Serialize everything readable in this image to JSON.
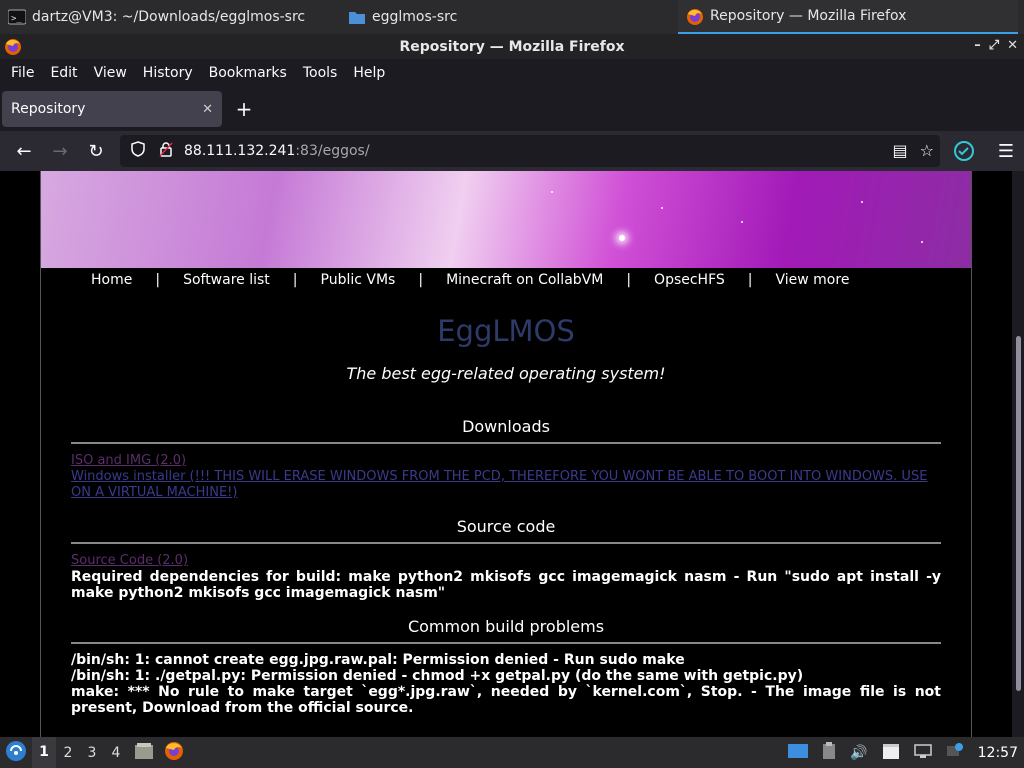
{
  "taskbar_top": {
    "items": [
      {
        "label": "dartz@VM3: ~/Downloads/egglmos-src",
        "icon": "terminal-icon"
      },
      {
        "label": "egglmos-src",
        "icon": "folder-icon"
      },
      {
        "label": "Repository — Mozilla Firefox",
        "icon": "firefox-icon",
        "active": true
      }
    ]
  },
  "window": {
    "title": "Repository — Mozilla Firefox"
  },
  "menubar": [
    "File",
    "Edit",
    "View",
    "History",
    "Bookmarks",
    "Tools",
    "Help"
  ],
  "tab": {
    "title": "Repository"
  },
  "url": {
    "host": "88.111.132.241",
    "path": ":83/eggos/"
  },
  "page": {
    "nav": [
      "Home",
      "Software list",
      "Public VMs",
      "Minecraft on CollabVM",
      "OpsecHFS",
      "View more"
    ],
    "nav_sep": "|",
    "title": "EggLMOS",
    "tagline": "The best egg-related operating system!",
    "downloads_heading": "Downloads",
    "download_iso": "ISO and IMG (2.0)",
    "download_windows": "Windows installer (!!! THIS WILL ERASE WINDOWS FROM THE PCD, THEREFORE YOU WONT BE ABLE TO BOOT INTO WINDOWS. USE ON A VIRTUAL MACHINE!)",
    "source_heading": "Source code",
    "source_link": "Source Code (2.0)",
    "source_deps": "Required dependencies for build: make python2 mkisofs gcc imagemagick nasm - Run \"sudo apt install -y make python2 mkisofs gcc imagemagick nasm\"",
    "problems_heading": "Common build problems",
    "problems": [
      "/bin/sh: 1: cannot create egg.jpg.raw.pal: Permission denied - Run sudo make",
      "/bin/sh: 1: ./getpal.py: Permission denied - chmod +x getpal.py (do the same with getpic.py)",
      "make: *** No rule to make target `egg*.jpg.raw`, needed by `kernel.com`, Stop. - The image file is not present, Download from the official source."
    ]
  },
  "taskbar_bottom": {
    "workspaces": [
      "1",
      "2",
      "3",
      "4"
    ],
    "clock": "12:57"
  },
  "colors": {
    "accent": "#3d9ee8",
    "page_title": "#2e3a68",
    "link": "#3a3a8c"
  }
}
